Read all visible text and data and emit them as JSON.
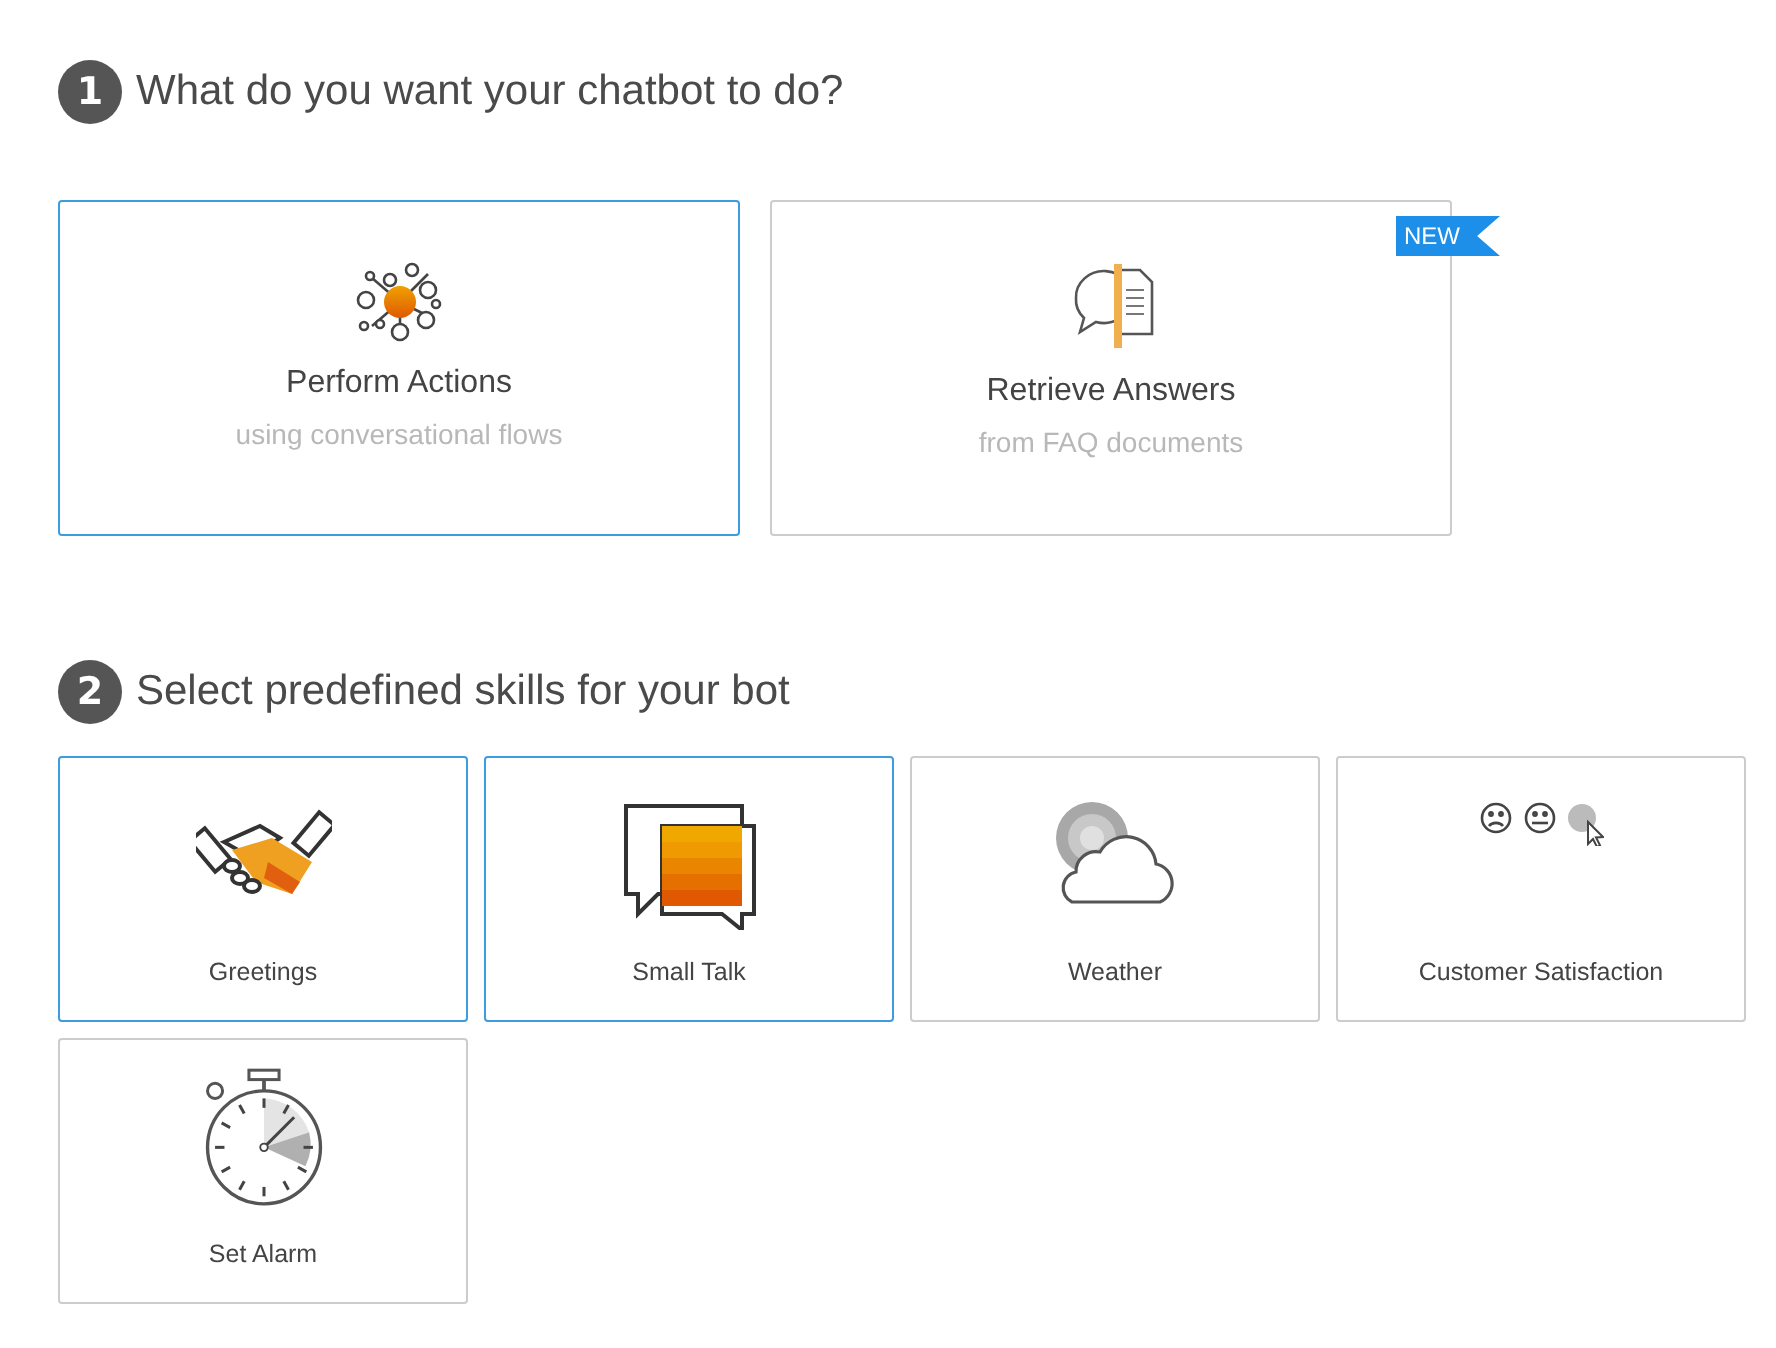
{
  "sections": [
    {
      "number": "1",
      "title": "What do you want your chatbot to do?",
      "kind": "options",
      "cards": [
        {
          "kind": "network",
          "title": "Perform Actions",
          "subtitle": "using conversational flows",
          "selected": true
        },
        {
          "kind": "faq",
          "title": "Retrieve Answers",
          "subtitle": "from FAQ documents",
          "selected": false,
          "badge": "NEW"
        }
      ]
    },
    {
      "number": "2",
      "title": "Select predefined skills for your bot",
      "kind": "skills",
      "cards": [
        {
          "kind": "handshake",
          "title": "Greetings",
          "selected": true
        },
        {
          "kind": "chat",
          "title": "Small Talk",
          "selected": true
        },
        {
          "kind": "weather",
          "title": "Weather",
          "selected": false
        },
        {
          "kind": "faces",
          "title": "Customer Satisfaction",
          "selected": false
        },
        {
          "kind": "stopwatch",
          "title": "Set Alarm",
          "selected": false
        }
      ]
    }
  ]
}
